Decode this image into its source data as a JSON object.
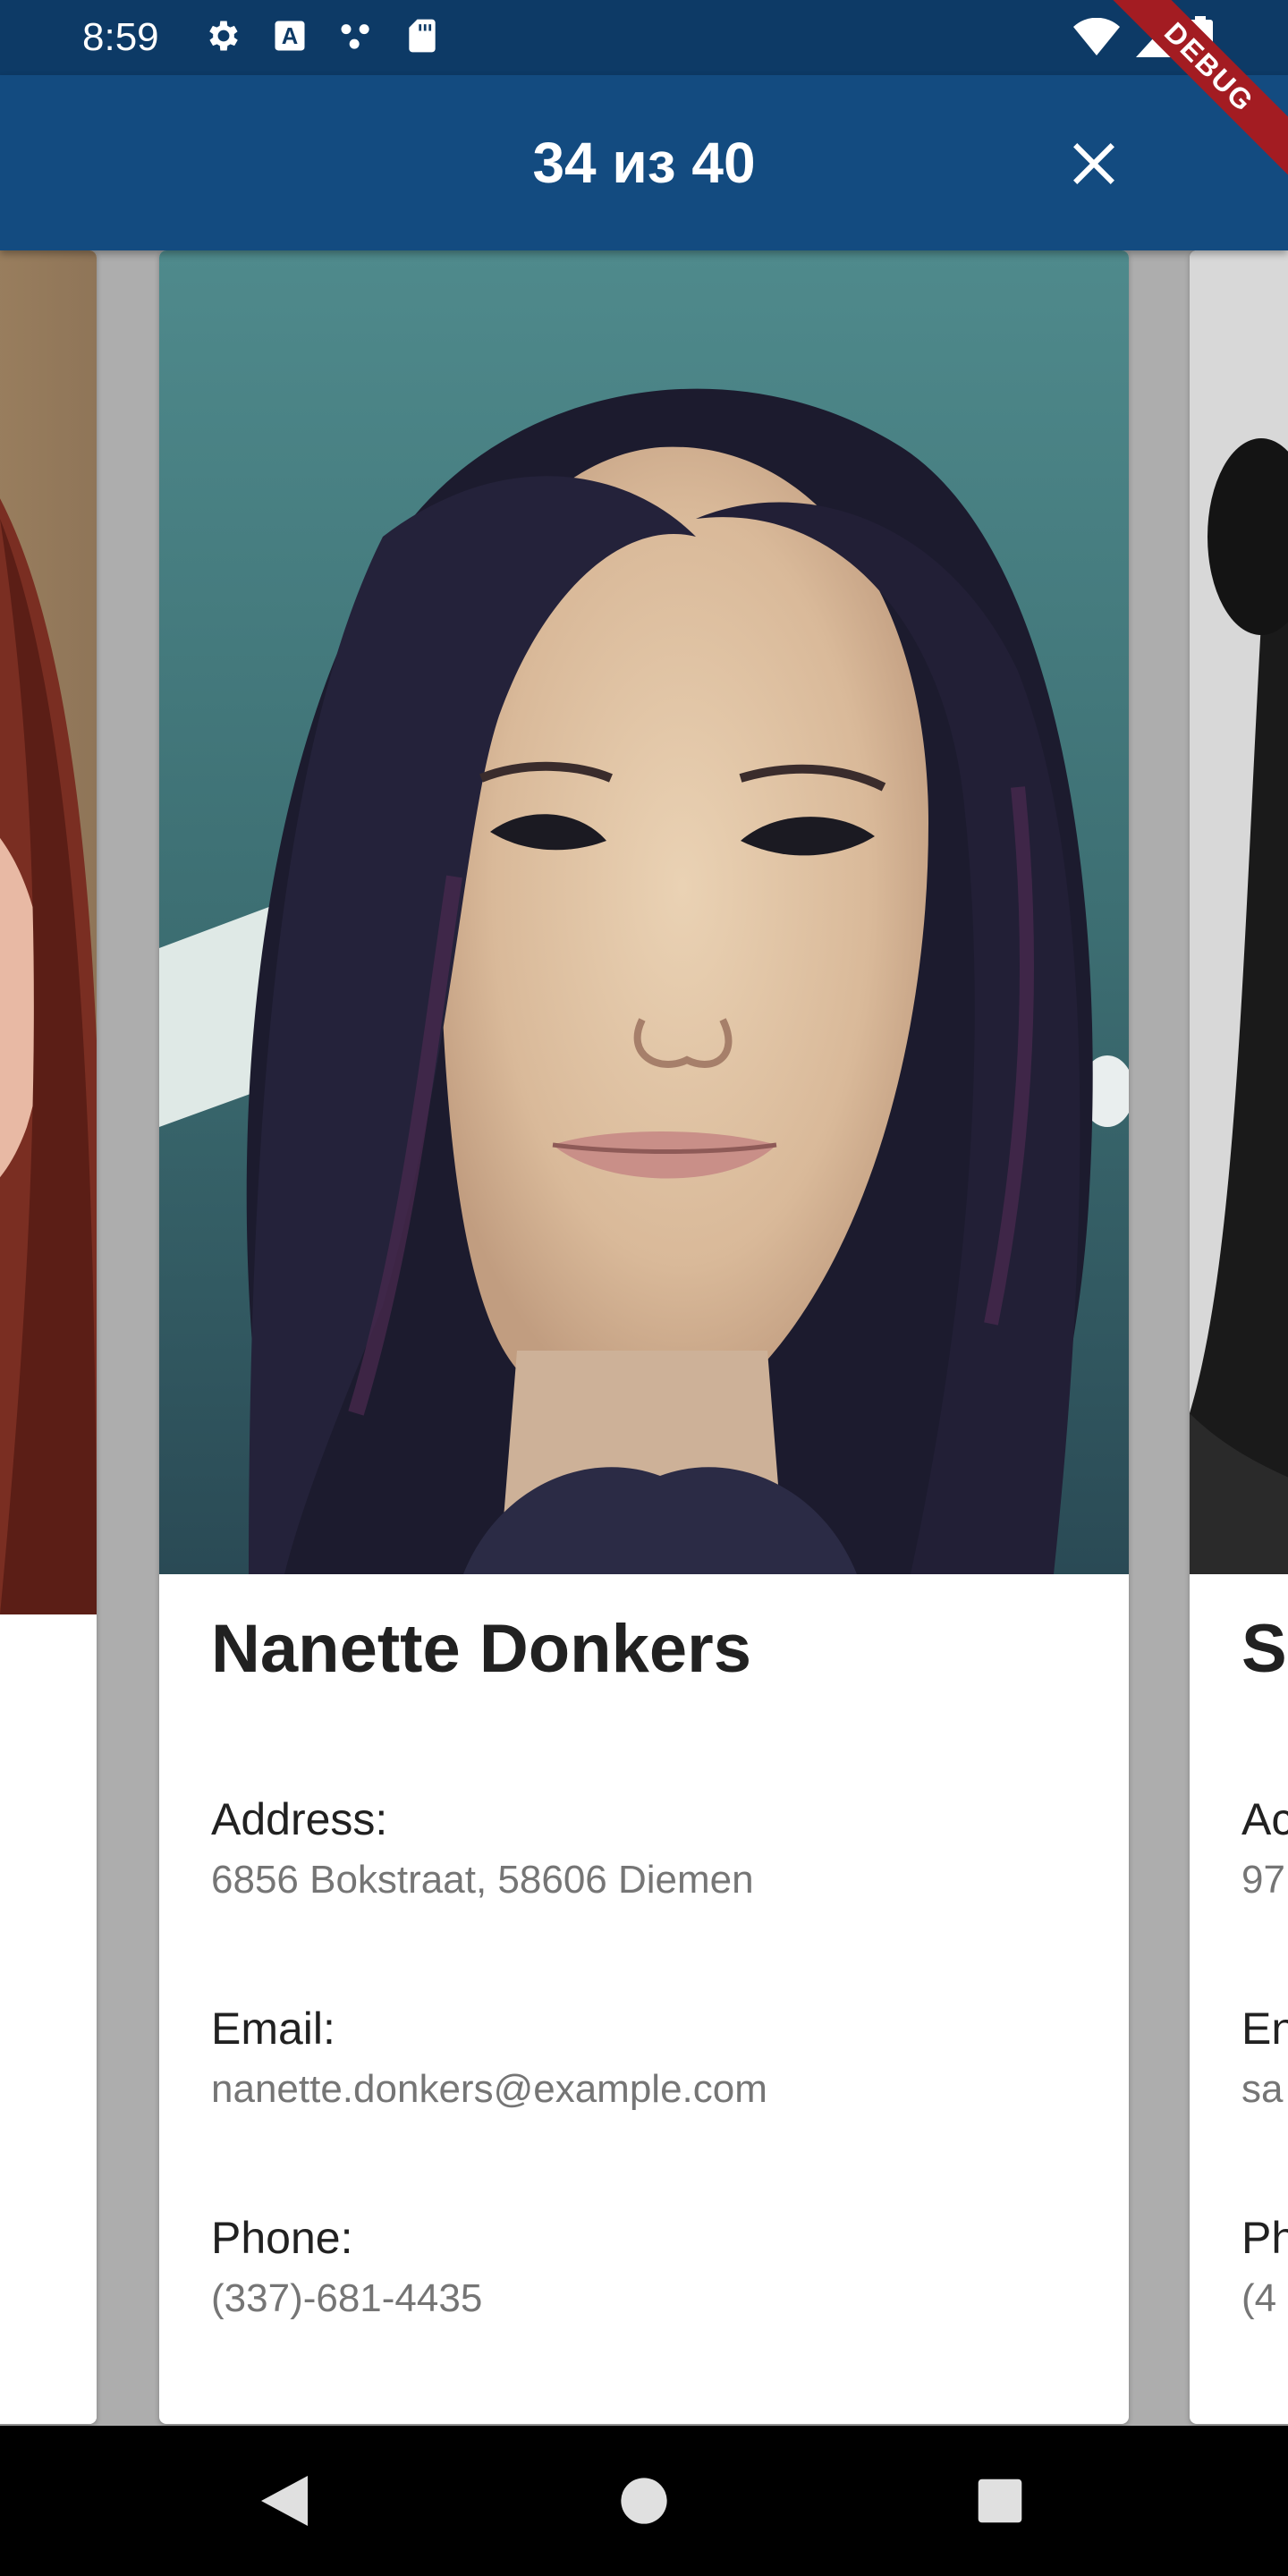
{
  "status_bar": {
    "time": "8:59",
    "left_icons": [
      "settings-icon",
      "a-badge-icon",
      "dots-icon",
      "sd-card-icon"
    ],
    "right_icons": [
      "wifi-icon",
      "signal-icon",
      "battery-icon"
    ]
  },
  "app_bar": {
    "title": "34 из 40",
    "close_icon": "close-icon",
    "color": "#134b80"
  },
  "debug_banner": "DEBUG",
  "cards": {
    "main": {
      "name": "Nanette Donkers",
      "address_label": "Address:",
      "address_value": "6856 Bokstraat, 58606 Diemen",
      "email_label": "Email:",
      "email_value": "nanette.donkers@example.com",
      "phone_label": "Phone:",
      "phone_value": "(337)-681-4435"
    },
    "right_partial": {
      "name": "S",
      "address_label": "Ac",
      "address_value": "97",
      "email_label": "En",
      "email_value": "sa",
      "phone_label": "Ph",
      "phone_value": "(4"
    }
  },
  "nav_bar": {
    "back_icon": "back-triangle-icon",
    "home_icon": "home-circle-icon",
    "recents_icon": "recents-square-icon"
  }
}
